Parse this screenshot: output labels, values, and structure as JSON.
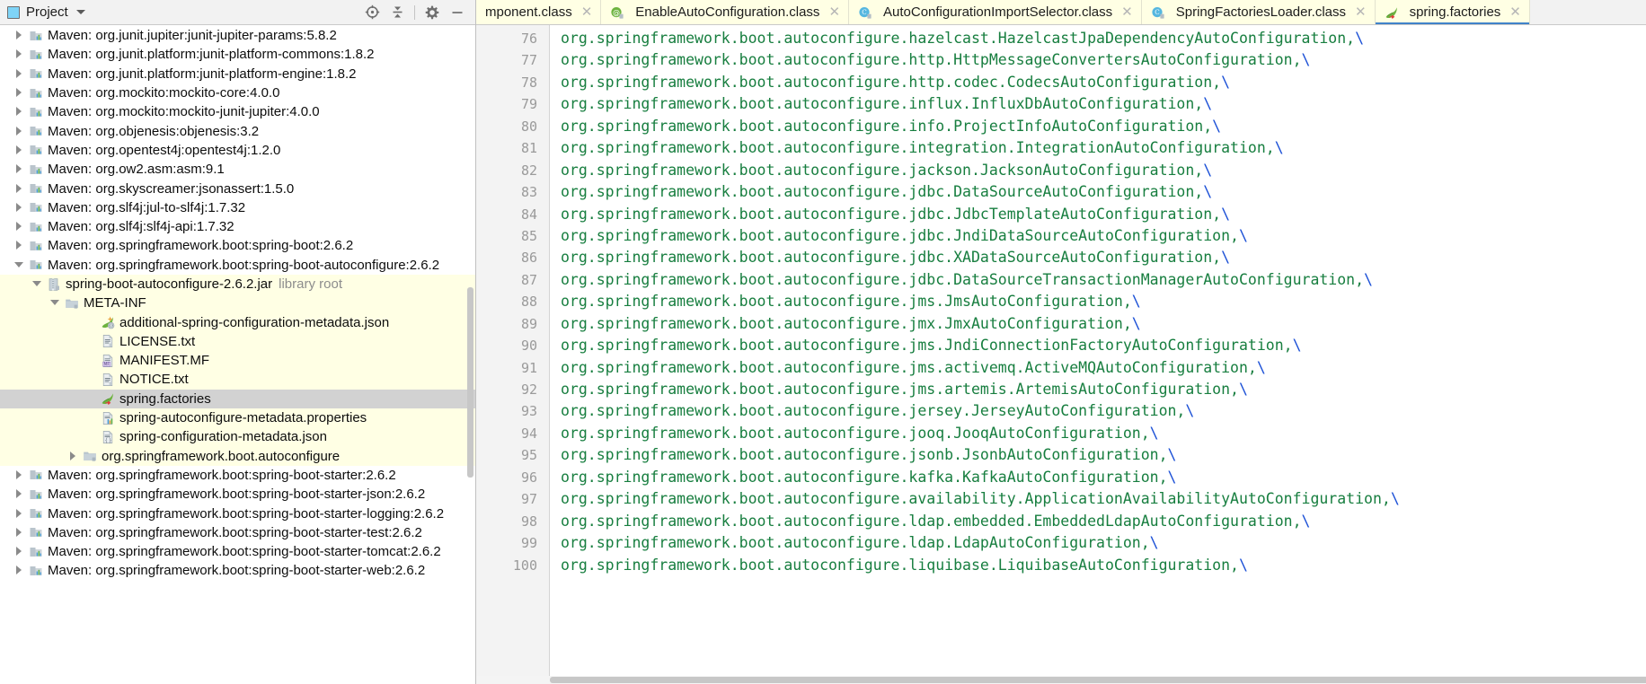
{
  "panel": {
    "title": "Project",
    "icons": {
      "project": "project-window-icon",
      "dropdown": "chevron-down-icon",
      "locate": "locate-target-icon",
      "collapse_all": "collapse-all-icon",
      "settings": "gear-icon",
      "hide": "minimize-icon"
    }
  },
  "tree": {
    "items": [
      {
        "label": "Maven: org.junit.jupiter:junit-jupiter-params:5.8.2",
        "indent": 0,
        "twisty": "closed",
        "icon": "maven-library-icon",
        "state": "normal"
      },
      {
        "label": "Maven: org.junit.platform:junit-platform-commons:1.8.2",
        "indent": 0,
        "twisty": "closed",
        "icon": "maven-library-icon",
        "state": "normal"
      },
      {
        "label": "Maven: org.junit.platform:junit-platform-engine:1.8.2",
        "indent": 0,
        "twisty": "closed",
        "icon": "maven-library-icon",
        "state": "normal"
      },
      {
        "label": "Maven: org.mockito:mockito-core:4.0.0",
        "indent": 0,
        "twisty": "closed",
        "icon": "maven-library-icon",
        "state": "normal"
      },
      {
        "label": "Maven: org.mockito:mockito-junit-jupiter:4.0.0",
        "indent": 0,
        "twisty": "closed",
        "icon": "maven-library-icon",
        "state": "normal"
      },
      {
        "label": "Maven: org.objenesis:objenesis:3.2",
        "indent": 0,
        "twisty": "closed",
        "icon": "maven-library-icon",
        "state": "normal"
      },
      {
        "label": "Maven: org.opentest4j:opentest4j:1.2.0",
        "indent": 0,
        "twisty": "closed",
        "icon": "maven-library-icon",
        "state": "normal"
      },
      {
        "label": "Maven: org.ow2.asm:asm:9.1",
        "indent": 0,
        "twisty": "closed",
        "icon": "maven-library-icon",
        "state": "normal"
      },
      {
        "label": "Maven: org.skyscreamer:jsonassert:1.5.0",
        "indent": 0,
        "twisty": "closed",
        "icon": "maven-library-icon",
        "state": "normal"
      },
      {
        "label": "Maven: org.slf4j:jul-to-slf4j:1.7.32",
        "indent": 0,
        "twisty": "closed",
        "icon": "maven-library-icon",
        "state": "normal"
      },
      {
        "label": "Maven: org.slf4j:slf4j-api:1.7.32",
        "indent": 0,
        "twisty": "closed",
        "icon": "maven-library-icon",
        "state": "normal"
      },
      {
        "label": "Maven: org.springframework.boot:spring-boot:2.6.2",
        "indent": 0,
        "twisty": "closed",
        "icon": "maven-library-icon",
        "state": "normal"
      },
      {
        "label": "Maven: org.springframework.boot:spring-boot-autoconfigure:2.6.2",
        "indent": 0,
        "twisty": "open",
        "icon": "maven-library-icon",
        "state": "normal"
      },
      {
        "label": "spring-boot-autoconfigure-2.6.2.jar",
        "suffix": "library root",
        "indent": 1,
        "twisty": "open",
        "icon": "jar-icon",
        "state": "jar"
      },
      {
        "label": "META-INF",
        "indent": 2,
        "twisty": "open",
        "icon": "folder-icon",
        "state": "jar"
      },
      {
        "label": "additional-spring-configuration-metadata.json",
        "indent": 4,
        "twisty": "none",
        "icon": "spring-json-icon",
        "state": "jar"
      },
      {
        "label": "LICENSE.txt",
        "indent": 4,
        "twisty": "none",
        "icon": "text-file-icon",
        "state": "jar"
      },
      {
        "label": "MANIFEST.MF",
        "indent": 4,
        "twisty": "none",
        "icon": "manifest-icon",
        "state": "jar"
      },
      {
        "label": "NOTICE.txt",
        "indent": 4,
        "twisty": "none",
        "icon": "text-file-icon",
        "state": "jar"
      },
      {
        "label": "spring.factories",
        "indent": 4,
        "twisty": "none",
        "icon": "spring-leaf-icon",
        "state": "selected"
      },
      {
        "label": "spring-autoconfigure-metadata.properties",
        "indent": 4,
        "twisty": "none",
        "icon": "properties-file-icon",
        "state": "jar"
      },
      {
        "label": "spring-configuration-metadata.json",
        "indent": 4,
        "twisty": "none",
        "icon": "json-file-icon",
        "state": "jar"
      },
      {
        "label": "org.springframework.boot.autoconfigure",
        "indent": 3,
        "twisty": "closed",
        "icon": "folder-icon",
        "state": "jar"
      },
      {
        "label": "Maven: org.springframework.boot:spring-boot-starter:2.6.2",
        "indent": 0,
        "twisty": "closed",
        "icon": "maven-library-icon",
        "state": "normal"
      },
      {
        "label": "Maven: org.springframework.boot:spring-boot-starter-json:2.6.2",
        "indent": 0,
        "twisty": "closed",
        "icon": "maven-library-icon",
        "state": "normal"
      },
      {
        "label": "Maven: org.springframework.boot:spring-boot-starter-logging:2.6.2",
        "indent": 0,
        "twisty": "closed",
        "icon": "maven-library-icon",
        "state": "normal"
      },
      {
        "label": "Maven: org.springframework.boot:spring-boot-starter-test:2.6.2",
        "indent": 0,
        "twisty": "closed",
        "icon": "maven-library-icon",
        "state": "normal"
      },
      {
        "label": "Maven: org.springframework.boot:spring-boot-starter-tomcat:2.6.2",
        "indent": 0,
        "twisty": "closed",
        "icon": "maven-library-icon",
        "state": "normal"
      },
      {
        "label": "Maven: org.springframework.boot:spring-boot-starter-web:2.6.2",
        "indent": 0,
        "twisty": "closed",
        "icon": "maven-library-icon",
        "state": "normal"
      }
    ]
  },
  "tabs": [
    {
      "label": "mponent.class",
      "icon": "class-icon",
      "active": false,
      "truncated": true
    },
    {
      "label": "EnableAutoConfiguration.class",
      "icon": "annotation-icon",
      "active": false
    },
    {
      "label": "AutoConfigurationImportSelector.class",
      "icon": "class-icon",
      "active": false
    },
    {
      "label": "SpringFactoriesLoader.class",
      "icon": "class-icon",
      "active": false
    },
    {
      "label": "spring.factories",
      "icon": "spring-leaf-icon",
      "active": true
    }
  ],
  "editor": {
    "first_line": 76,
    "lines": [
      {
        "n": "76",
        "text": "org.springframework.boot.autoconfigure.hazelcast.HazelcastJpaDependencyAutoConfiguration,",
        "cont": "\\"
      },
      {
        "n": "77",
        "text": "org.springframework.boot.autoconfigure.http.HttpMessageConvertersAutoConfiguration,",
        "cont": "\\"
      },
      {
        "n": "78",
        "text": "org.springframework.boot.autoconfigure.http.codec.CodecsAutoConfiguration,",
        "cont": "\\"
      },
      {
        "n": "79",
        "text": "org.springframework.boot.autoconfigure.influx.InfluxDbAutoConfiguration,",
        "cont": "\\"
      },
      {
        "n": "80",
        "text": "org.springframework.boot.autoconfigure.info.ProjectInfoAutoConfiguration,",
        "cont": "\\"
      },
      {
        "n": "81",
        "text": "org.springframework.boot.autoconfigure.integration.IntegrationAutoConfiguration,",
        "cont": "\\"
      },
      {
        "n": "82",
        "text": "org.springframework.boot.autoconfigure.jackson.JacksonAutoConfiguration,",
        "cont": "\\"
      },
      {
        "n": "83",
        "text": "org.springframework.boot.autoconfigure.jdbc.DataSourceAutoConfiguration,",
        "cont": "\\"
      },
      {
        "n": "84",
        "text": "org.springframework.boot.autoconfigure.jdbc.JdbcTemplateAutoConfiguration,",
        "cont": "\\"
      },
      {
        "n": "85",
        "text": "org.springframework.boot.autoconfigure.jdbc.JndiDataSourceAutoConfiguration,",
        "cont": "\\"
      },
      {
        "n": "86",
        "text": "org.springframework.boot.autoconfigure.jdbc.XADataSourceAutoConfiguration,",
        "cont": "\\"
      },
      {
        "n": "87",
        "text": "org.springframework.boot.autoconfigure.jdbc.DataSourceTransactionManagerAutoConfiguration,",
        "cont": "\\"
      },
      {
        "n": "88",
        "text": "org.springframework.boot.autoconfigure.jms.JmsAutoConfiguration,",
        "cont": "\\"
      },
      {
        "n": "89",
        "text": "org.springframework.boot.autoconfigure.jmx.JmxAutoConfiguration,",
        "cont": "\\"
      },
      {
        "n": "90",
        "text": "org.springframework.boot.autoconfigure.jms.JndiConnectionFactoryAutoConfiguration,",
        "cont": "\\"
      },
      {
        "n": "91",
        "text": "org.springframework.boot.autoconfigure.jms.activemq.ActiveMQAutoConfiguration,",
        "cont": "\\"
      },
      {
        "n": "92",
        "text": "org.springframework.boot.autoconfigure.jms.artemis.ArtemisAutoConfiguration,",
        "cont": "\\"
      },
      {
        "n": "93",
        "text": "org.springframework.boot.autoconfigure.jersey.JerseyAutoConfiguration,",
        "cont": "\\"
      },
      {
        "n": "94",
        "text": "org.springframework.boot.autoconfigure.jooq.JooqAutoConfiguration,",
        "cont": "\\"
      },
      {
        "n": "95",
        "text": "org.springframework.boot.autoconfigure.jsonb.JsonbAutoConfiguration,",
        "cont": "\\"
      },
      {
        "n": "96",
        "text": "org.springframework.boot.autoconfigure.kafka.KafkaAutoConfiguration,",
        "cont": "\\"
      },
      {
        "n": "97",
        "text": "org.springframework.boot.autoconfigure.availability.ApplicationAvailabilityAutoConfiguration,",
        "cont": "\\"
      },
      {
        "n": "98",
        "text": "org.springframework.boot.autoconfigure.ldap.embedded.EmbeddedLdapAutoConfiguration,",
        "cont": "\\"
      },
      {
        "n": "99",
        "text": "org.springframework.boot.autoconfigure.ldap.LdapAutoConfiguration,",
        "cont": "\\"
      },
      {
        "n": "100",
        "text": "org.springframework.boot.autoconfigure.liquibase.LiquibaseAutoConfiguration,",
        "cont": "\\"
      }
    ]
  },
  "colors": {
    "code_green": "#177e3f",
    "backslash_blue": "#1a4fd6",
    "jar_highlight": "#ffffe4",
    "selection_gray": "#d2d2d2",
    "tab_active_underline": "#4083c9",
    "gutter_bg": "#f3f3f3"
  }
}
